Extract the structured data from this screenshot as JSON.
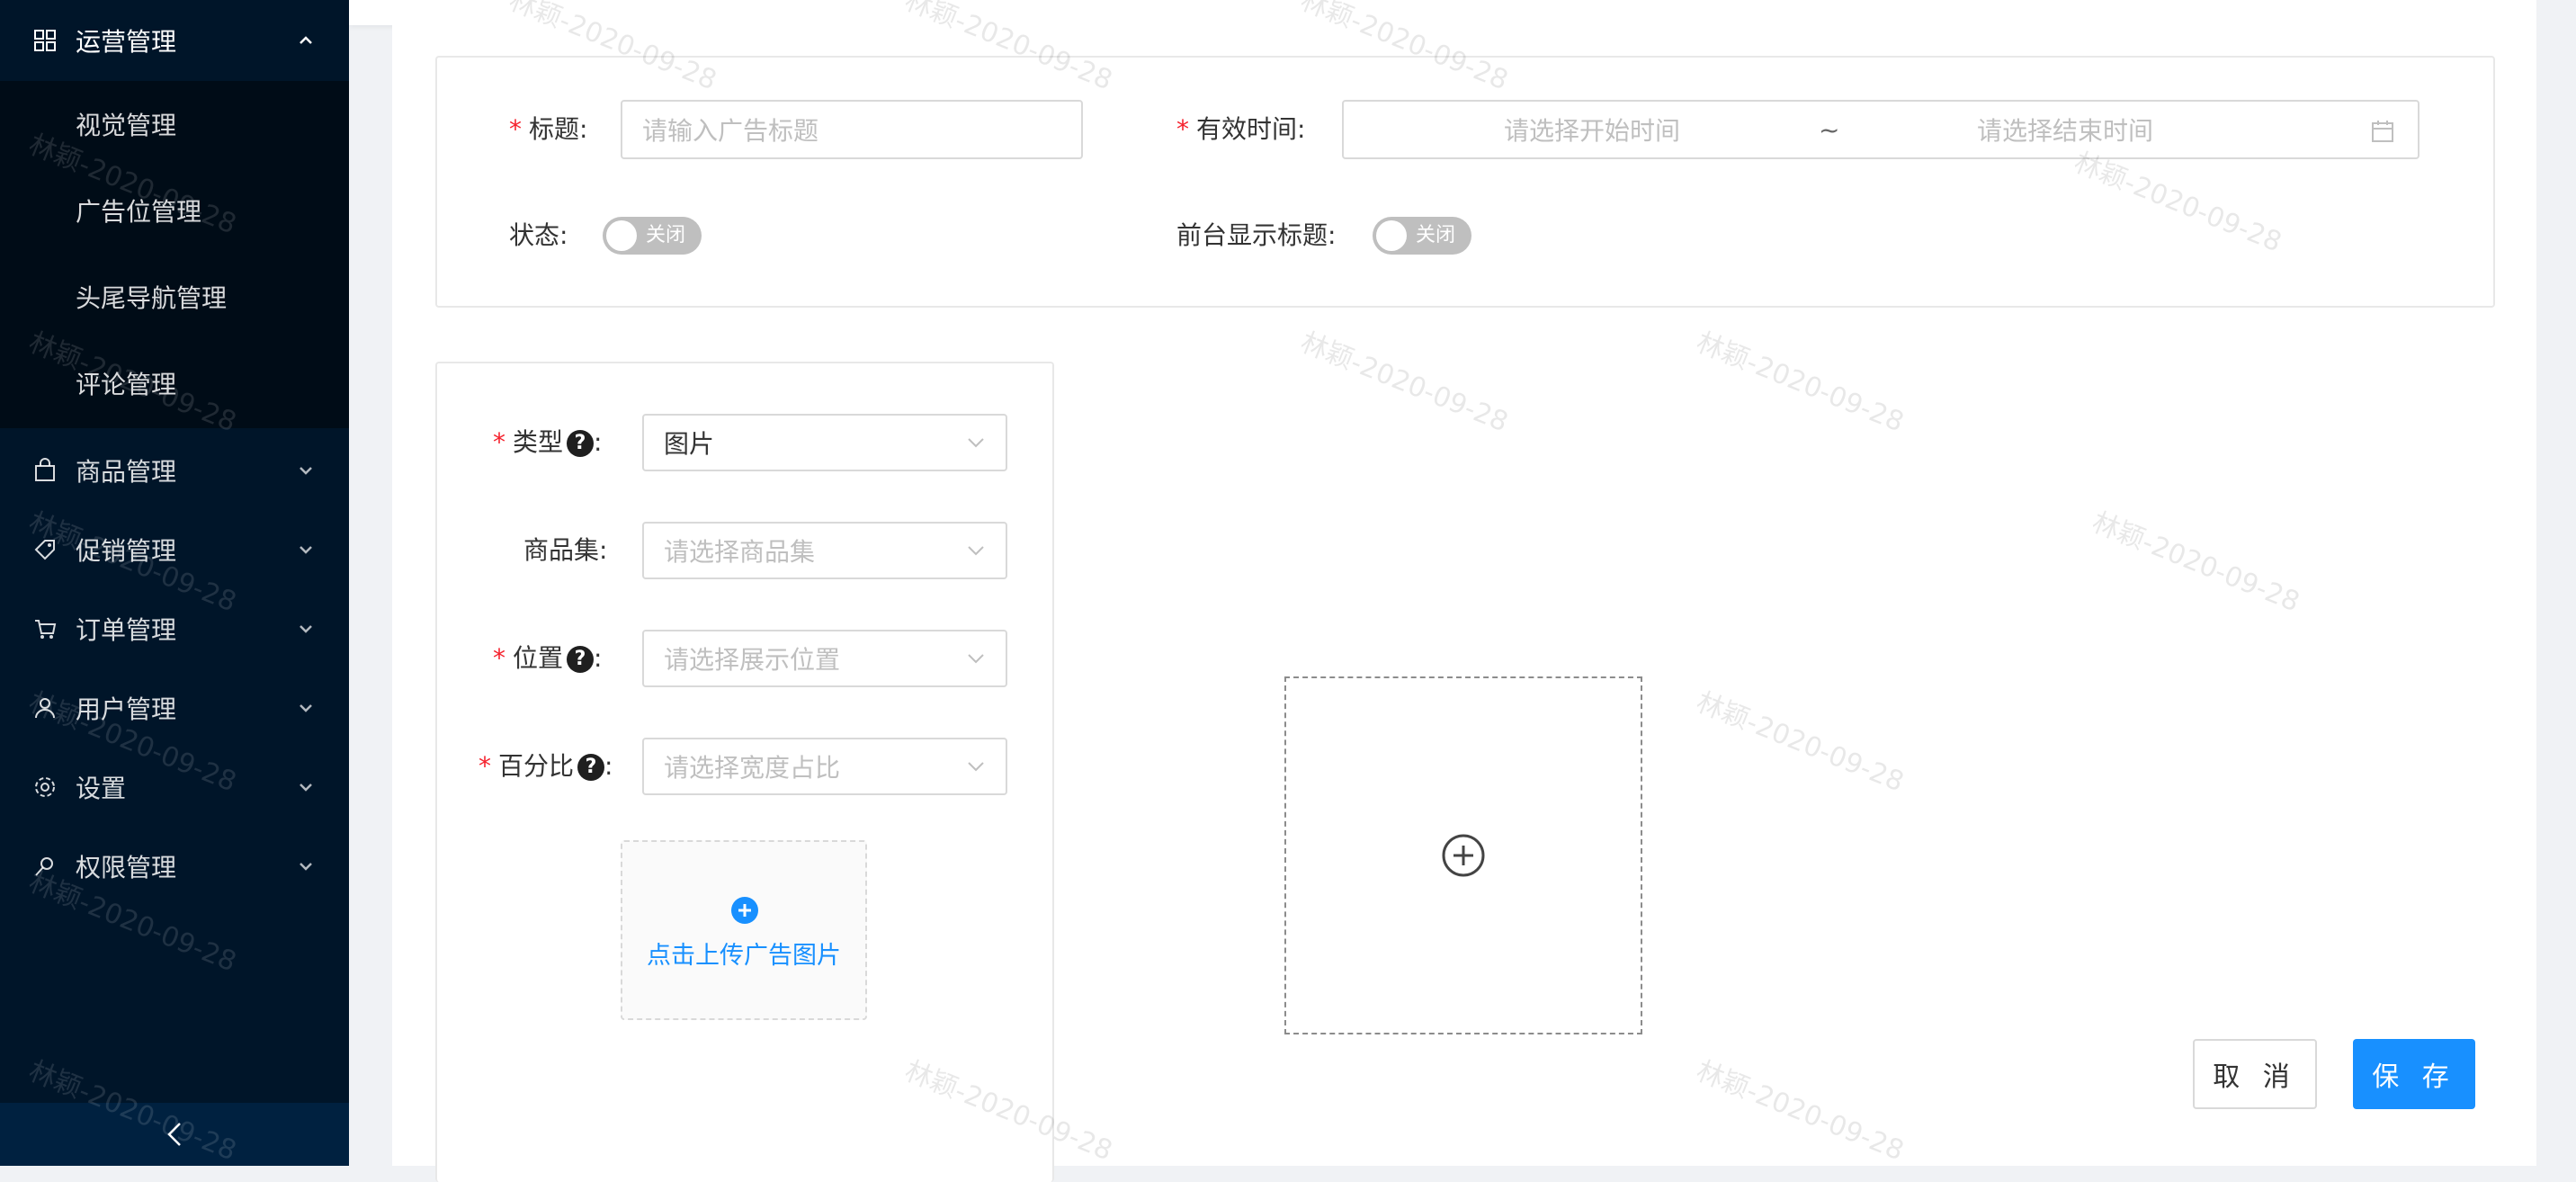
{
  "sidebar": {
    "open_menu": {
      "label": "运营管理",
      "icon": "grid-icon"
    },
    "sub_items": [
      {
        "label": "视觉管理"
      },
      {
        "label": "广告位管理"
      },
      {
        "label": "头尾导航管理"
      },
      {
        "label": "评论管理"
      }
    ],
    "menus": [
      {
        "label": "商品管理",
        "icon": "shopping-bag-icon"
      },
      {
        "label": "促销管理",
        "icon": "tag-icon"
      },
      {
        "label": "订单管理",
        "icon": "cart-icon"
      },
      {
        "label": "用户管理",
        "icon": "user-icon"
      },
      {
        "label": "设置",
        "icon": "gear-icon"
      },
      {
        "label": "权限管理",
        "icon": "key-icon"
      }
    ],
    "collapse_icon": "chevron-left-icon"
  },
  "form": {
    "title_label": "标题",
    "title_placeholder": "请输入广告标题",
    "valid_time_label": "有效时间",
    "start_placeholder": "请选择开始时间",
    "range_separator": "~",
    "end_placeholder": "请选择结束时间",
    "status_label": "状态",
    "status_switch": "关闭",
    "show_title_label": "前台显示标题",
    "show_title_switch": "关闭",
    "colon": ":"
  },
  "ad_item": {
    "type_label": "类型",
    "type_value": "图片",
    "product_set_label": "商品集",
    "product_set_placeholder": "请选择商品集",
    "position_label": "位置",
    "position_placeholder": "请选择展示位置",
    "percent_label": "百分比",
    "percent_placeholder": "请选择宽度占比",
    "upload_text": "点击上传广告图片",
    "help_mark": "?"
  },
  "actions": {
    "cancel": "取 消",
    "save": "保 存"
  },
  "watermark_text": "林颖-2020-09-28",
  "colors": {
    "sidebar_bg": "#001529",
    "submenu_bg": "#000c17",
    "primary": "#1890ff",
    "required": "#f5222d"
  }
}
